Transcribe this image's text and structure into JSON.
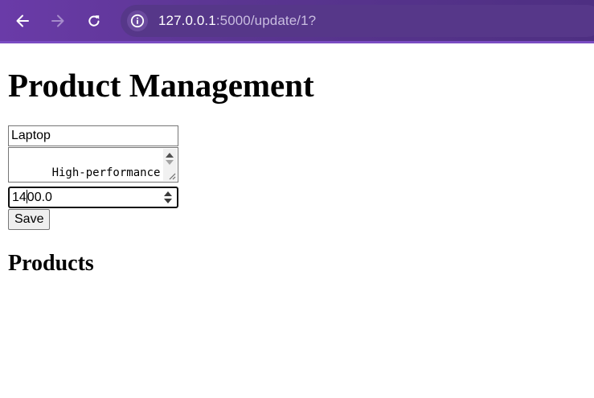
{
  "browser": {
    "url_host": "127.0.0.1",
    "url_rest": ":5000/update/1?",
    "icons": {
      "back": "arrow-left-icon",
      "forward": "arrow-right-icon",
      "reload": "reload-icon",
      "site_info": "info-icon"
    },
    "colors": {
      "toolbar": "#5a3591",
      "omnibox": "#563789"
    }
  },
  "page": {
    "title": "Product Management",
    "form": {
      "name_value": "Laptop",
      "description_value": "High-performance laptop with SSD",
      "price_before_caret": "14",
      "price_after_caret": "00.0",
      "save_label": "Save"
    },
    "products_heading": "Products"
  }
}
